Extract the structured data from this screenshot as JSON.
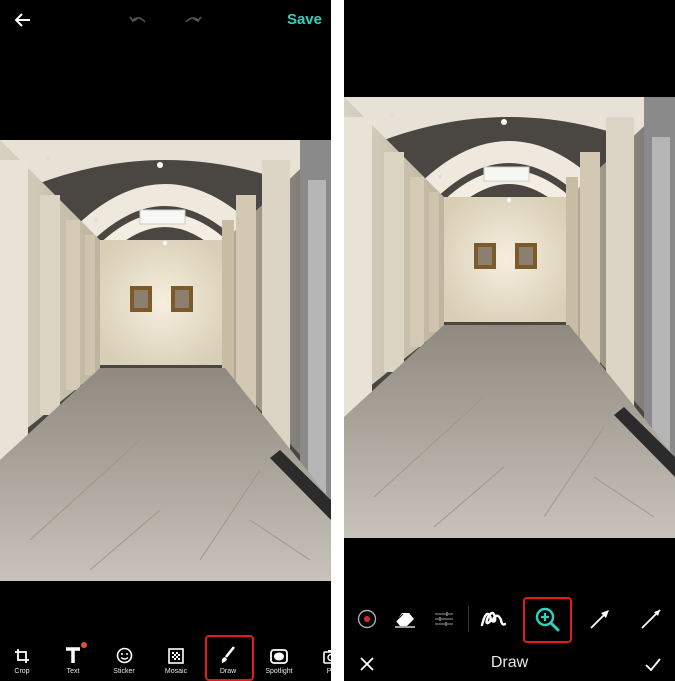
{
  "colors": {
    "accent": "#2fd1c2",
    "highlight": "#e31b1b",
    "background": "#000000"
  },
  "left_screen": {
    "topbar": {
      "back_icon": "arrow-left-icon",
      "undo_icon": "undo-icon",
      "redo_icon": "redo-icon",
      "save_label": "Save"
    },
    "tools": [
      {
        "label": "Crop",
        "icon": "crop-icon"
      },
      {
        "label": "Text",
        "icon": "text-icon",
        "badge": true
      },
      {
        "label": "Sticker",
        "icon": "smiley-icon"
      },
      {
        "label": "Mosaic",
        "icon": "mosaic-icon"
      },
      {
        "label": "Draw",
        "icon": "brush-icon",
        "selected": true
      },
      {
        "label": "Spotlight",
        "icon": "spotlight-icon"
      },
      {
        "label": "Ph",
        "icon": "camera-icon"
      }
    ]
  },
  "right_screen": {
    "draw_tools": [
      {
        "icon": "color-picker-icon"
      },
      {
        "icon": "eraser-icon"
      },
      {
        "icon": "adjust-sliders-icon"
      },
      {
        "icon": "freehand-icon"
      },
      {
        "icon": "magnifier-plus-icon",
        "selected": true
      },
      {
        "icon": "arrow-line-icon"
      },
      {
        "icon": "straight-line-icon"
      }
    ],
    "footer": {
      "cancel_icon": "close-icon",
      "title": "Draw",
      "confirm_icon": "check-icon"
    }
  }
}
